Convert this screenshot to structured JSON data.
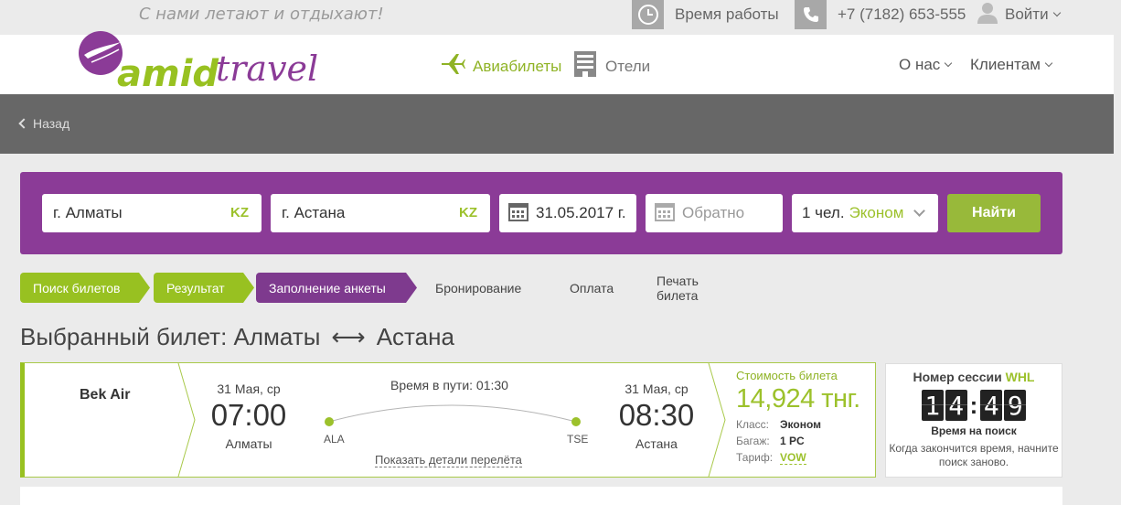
{
  "topbar": {
    "slogan": "С нами летают и отдыхают!",
    "hours_label": "Время работы",
    "phone": "+7 (7182) 653-555",
    "login_label": "Войти"
  },
  "header": {
    "logo_text": "amid travel",
    "nav": {
      "flights": "Авиабилеты",
      "hotels": "Отели",
      "about": "О нас",
      "clients": "Клиентам"
    }
  },
  "backbar": {
    "back_label": "Назад"
  },
  "search": {
    "from_city": "г. Алматы",
    "from_code": "KZ",
    "to_city": "г. Астана",
    "to_code": "KZ",
    "date": "31.05.2017 г.",
    "return_placeholder": "Обратно",
    "passengers": "1 чел.",
    "class": "Эконом",
    "find_label": "Найти"
  },
  "steps": [
    {
      "label": "Поиск билетов",
      "state": "done"
    },
    {
      "label": "Результат",
      "state": "done"
    },
    {
      "label": "Заполнение анкеты",
      "state": "active"
    },
    {
      "label": "Бронирование",
      "state": "pending"
    },
    {
      "label": "Оплата",
      "state": "pending"
    },
    {
      "label": "Печать билета",
      "state": "pending"
    }
  ],
  "title": {
    "prefix": "Выбранный билет: Алматы",
    "arrow": "⟷",
    "suffix": "Астана"
  },
  "ticket": {
    "airline": "Bek Air",
    "departure": {
      "date": "31 Мая, ср",
      "time": "07:00",
      "city": "Алматы",
      "code": "ALA"
    },
    "arrival": {
      "date": "31 Мая, ср",
      "time": "08:30",
      "city": "Астана",
      "code": "TSE"
    },
    "travel_time": "Время в пути: 01:30",
    "details_link": "Показать детали перелёта",
    "price_label": "Стоимость билета",
    "price": "14,924 тнг.",
    "class_key": "Класс:",
    "class_val": "Эконом",
    "baggage_key": "Багаж:",
    "baggage_val": "1 PC",
    "tariff_key": "Тариф:",
    "tariff_val": "VOW"
  },
  "session": {
    "title": "Номер сессии",
    "code": "WHL",
    "timer_minutes": "14",
    "timer_seconds": "49",
    "subtitle": "Время на поиск",
    "note": "Когда закончится время, начните поиск заново."
  },
  "colors": {
    "accent_green": "#98c121",
    "brand_purple": "#8b3b97",
    "active_step": "#7e3a8e",
    "dark_bar": "#676767"
  }
}
